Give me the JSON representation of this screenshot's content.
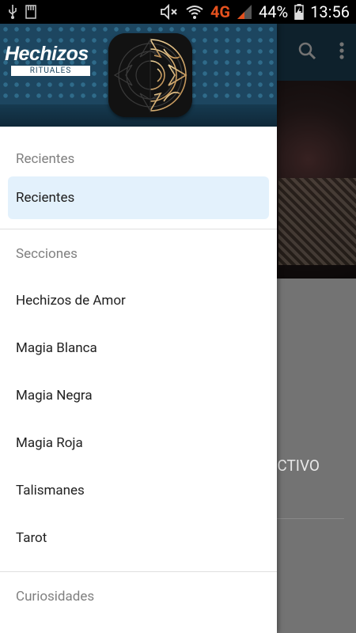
{
  "status_bar": {
    "battery": "44%",
    "time": "13:56",
    "network": "4G"
  },
  "drawer": {
    "brand": {
      "title": "Hechizos",
      "subtitle": "RITUALES"
    },
    "sections": [
      {
        "label": "Recientes",
        "items": [
          {
            "label": "Recientes",
            "active": true
          }
        ]
      },
      {
        "label": "Secciones",
        "items": [
          {
            "label": "Hechizos de Amor"
          },
          {
            "label": "Magia Blanca"
          },
          {
            "label": "Magia Negra"
          },
          {
            "label": "Magia Roja"
          },
          {
            "label": "Talismanes"
          },
          {
            "label": "Tarot"
          }
        ]
      },
      {
        "label": "Curiosidades",
        "items": []
      }
    ]
  },
  "background": {
    "peek_text": "CTIVO"
  },
  "colors": {
    "header": "#1d4660",
    "active_item_bg": "#e3f1fc",
    "section_label": "#808080"
  }
}
